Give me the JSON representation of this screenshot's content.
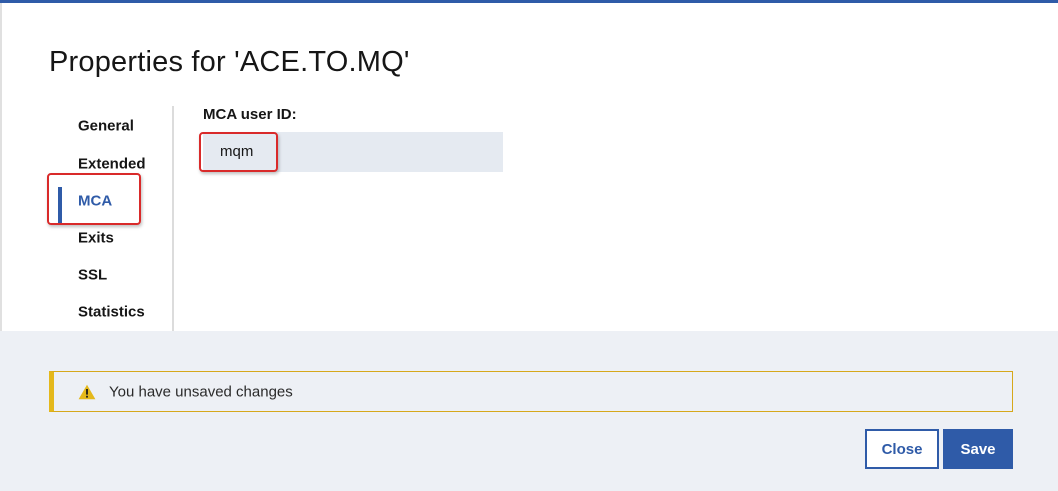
{
  "dialog": {
    "title": "Properties for 'ACE.TO.MQ'"
  },
  "nav": {
    "items": [
      {
        "label": "General"
      },
      {
        "label": "Extended"
      },
      {
        "label": "MCA"
      },
      {
        "label": "Exits"
      },
      {
        "label": "SSL"
      },
      {
        "label": "Statistics"
      }
    ],
    "active": "MCA"
  },
  "form": {
    "mca_user_id_label": "MCA user ID:",
    "mca_user_id_value": "mqm"
  },
  "notification": {
    "icon": "warning-icon",
    "message": "You have unsaved changes"
  },
  "buttons": {
    "close_label": "Close",
    "save_label": "Save"
  },
  "colors": {
    "accent": "#2f5ba8",
    "warning": "#e4b81b",
    "highlight_box": "#d92a2a",
    "footer_bg": "#edf0f5",
    "input_bg": "#e5eaf1"
  }
}
